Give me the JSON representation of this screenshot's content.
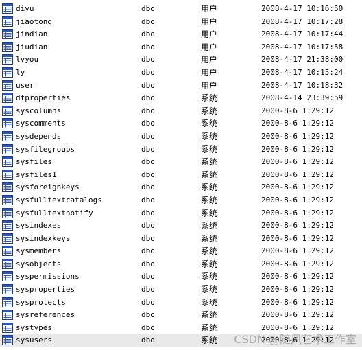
{
  "colors": {
    "icon_border": "#1f3b8a",
    "icon_header": "#2e56b8",
    "icon_lines": "#2e56b8",
    "selected_row": "#e9e9e9"
  },
  "icons": {
    "table": "table-icon"
  },
  "watermark": "CSDN @随风艺术工作室",
  "rows": [
    {
      "name": "diyu",
      "owner": "dbo",
      "type": "用户",
      "created": "2008-4-17 10:16:50"
    },
    {
      "name": "jiaotong",
      "owner": "dbo",
      "type": "用户",
      "created": "2008-4-17 10:17:28"
    },
    {
      "name": "jindian",
      "owner": "dbo",
      "type": "用户",
      "created": "2008-4-17 10:17:44"
    },
    {
      "name": "jiudian",
      "owner": "dbo",
      "type": "用户",
      "created": "2008-4-17 10:17:58"
    },
    {
      "name": "lvyou",
      "owner": "dbo",
      "type": "用户",
      "created": "2008-4-17 21:38:00"
    },
    {
      "name": "ly",
      "owner": "dbo",
      "type": "用户",
      "created": "2008-4-17 10:15:24"
    },
    {
      "name": "user",
      "owner": "dbo",
      "type": "用户",
      "created": "2008-4-17 10:18:32"
    },
    {
      "name": "dtproperties",
      "owner": "dbo",
      "type": "系统",
      "created": "2008-4-14 23:39:59"
    },
    {
      "name": "syscolumns",
      "owner": "dbo",
      "type": "系统",
      "created": "2000-8-6 1:29:12"
    },
    {
      "name": "syscomments",
      "owner": "dbo",
      "type": "系统",
      "created": "2000-8-6 1:29:12"
    },
    {
      "name": "sysdepends",
      "owner": "dbo",
      "type": "系统",
      "created": "2000-8-6 1:29:12"
    },
    {
      "name": "sysfilegroups",
      "owner": "dbo",
      "type": "系统",
      "created": "2000-8-6 1:29:12"
    },
    {
      "name": "sysfiles",
      "owner": "dbo",
      "type": "系统",
      "created": "2000-8-6 1:29:12"
    },
    {
      "name": "sysfiles1",
      "owner": "dbo",
      "type": "系统",
      "created": "2000-8-6 1:29:12"
    },
    {
      "name": "sysforeignkeys",
      "owner": "dbo",
      "type": "系统",
      "created": "2000-8-6 1:29:12"
    },
    {
      "name": "sysfulltextcatalogs",
      "owner": "dbo",
      "type": "系统",
      "created": "2000-8-6 1:29:12"
    },
    {
      "name": "sysfulltextnotify",
      "owner": "dbo",
      "type": "系统",
      "created": "2000-8-6 1:29:12"
    },
    {
      "name": "sysindexes",
      "owner": "dbo",
      "type": "系统",
      "created": "2000-8-6 1:29:12"
    },
    {
      "name": "sysindexkeys",
      "owner": "dbo",
      "type": "系统",
      "created": "2000-8-6 1:29:12"
    },
    {
      "name": "sysmembers",
      "owner": "dbo",
      "type": "系统",
      "created": "2000-8-6 1:29:12"
    },
    {
      "name": "sysobjects",
      "owner": "dbo",
      "type": "系统",
      "created": "2000-8-6 1:29:12"
    },
    {
      "name": "syspermissions",
      "owner": "dbo",
      "type": "系统",
      "created": "2000-8-6 1:29:12"
    },
    {
      "name": "sysproperties",
      "owner": "dbo",
      "type": "系统",
      "created": "2000-8-6 1:29:12"
    },
    {
      "name": "sysprotects",
      "owner": "dbo",
      "type": "系统",
      "created": "2000-8-6 1:29:12"
    },
    {
      "name": "sysreferences",
      "owner": "dbo",
      "type": "系统",
      "created": "2000-8-6 1:29:12"
    },
    {
      "name": "systypes",
      "owner": "dbo",
      "type": "系统",
      "created": "2000-8-6 1:29:12"
    },
    {
      "name": "sysusers",
      "owner": "dbo",
      "type": "系统",
      "created": "2000-8-6 1:29:12",
      "selected": true
    }
  ]
}
